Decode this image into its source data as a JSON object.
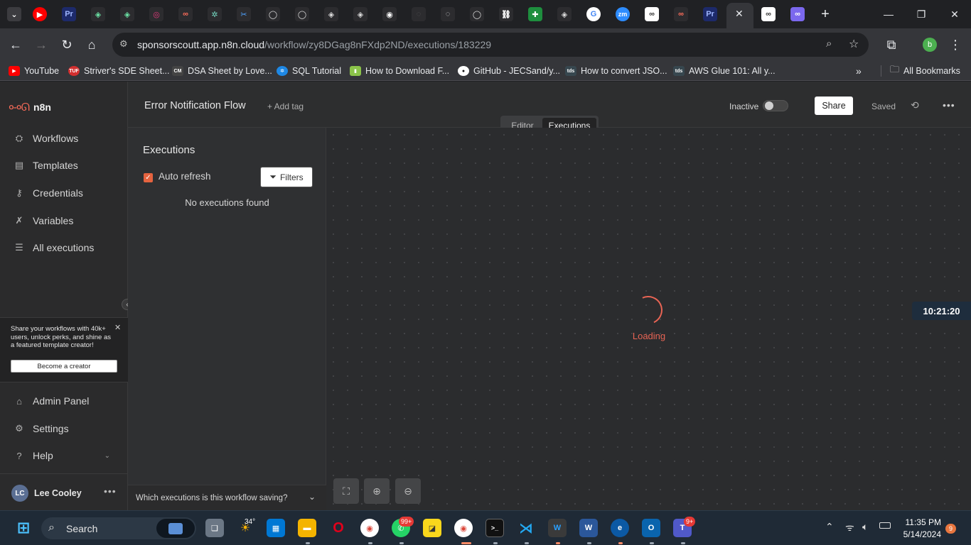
{
  "browser": {
    "url_host": "sponsorscoutt.app.n8n.cloud",
    "url_path": "/workflow/zy8DGag8nFXdp2ND/executions/183229",
    "tab_favicons": [
      "youtube-icon",
      "premiere-icon",
      "openai-icon",
      "openai-icon",
      "globe-icon",
      "n8n-icon",
      "chatgpt-icon",
      "scissors-icon",
      "github-icon",
      "github-icon",
      "openai-icon",
      "openai-icon",
      "chrome-icon",
      "loading-icon",
      "loading-icon",
      "github-icon",
      "link-icon",
      "sheets-icon",
      "openai-icon",
      "google-icon",
      "zoom-icon",
      "n8n-icon",
      "n8n-icon",
      "premiere-icon",
      "n8n-icon",
      "n8n-icon"
    ],
    "profile_initial": "b",
    "bookmarks": [
      {
        "label": "YouTube",
        "icon": "youtube-icon",
        "color": "#ff0000"
      },
      {
        "label": "Striver's SDE Sheet...",
        "icon": "tuf-icon",
        "color": "#d32f2f"
      },
      {
        "label": "DSA Sheet by Love...",
        "icon": "cm-icon",
        "color": "#444444"
      },
      {
        "label": "SQL Tutorial",
        "icon": "gear-icon",
        "color": "#1e88e5"
      },
      {
        "label": "How to Download F...",
        "icon": "android-icon",
        "color": "#8bc34a"
      },
      {
        "label": "GitHub - JECSand/y...",
        "icon": "github-icon",
        "color": "#333333"
      },
      {
        "label": "How to convert JSO...",
        "icon": "tds-icon",
        "color": "#37474f"
      },
      {
        "label": "AWS Glue 101: All y...",
        "icon": "tds-icon",
        "color": "#37474f"
      }
    ],
    "all_bookmarks": "All Bookmarks"
  },
  "sidebar": {
    "logo": "n8n",
    "items": [
      {
        "label": "Workflows",
        "icon": "workflows-icon"
      },
      {
        "label": "Templates",
        "icon": "templates-icon"
      },
      {
        "label": "Credentials",
        "icon": "key-icon"
      },
      {
        "label": "Variables",
        "icon": "variables-icon"
      },
      {
        "label": "All executions",
        "icon": "list-icon"
      }
    ],
    "promo_text": "Share your workflows with 40k+ users, unlock perks, and shine as a featured template creator!",
    "promo_button": "Become a creator",
    "bottom_items": [
      {
        "label": "Admin Panel",
        "icon": "home-icon"
      },
      {
        "label": "Settings",
        "icon": "gear-icon"
      },
      {
        "label": "Help",
        "icon": "question-icon"
      }
    ],
    "user_initials": "LC",
    "user_name": "Lee Cooley"
  },
  "header": {
    "workflow_name": "Error Notification Flow",
    "add_tag": "+ Add tag",
    "status": "Inactive",
    "share": "Share",
    "saved": "Saved",
    "tabs": {
      "editor": "Editor",
      "executions": "Executions"
    }
  },
  "executions": {
    "title": "Executions",
    "auto_refresh": "Auto refresh",
    "filters": "Filters",
    "empty": "No executions found",
    "saving_question": "Which executions is this workflow saving?"
  },
  "canvas": {
    "loading": "Loading",
    "clock": "10:21:20",
    "accent": "#e86454"
  },
  "taskbar": {
    "search": "Search",
    "weather": "34°",
    "whatsapp_badge": "99+",
    "teams_badge": "9+",
    "time": "11:35 PM",
    "date": "5/14/2024",
    "notification_count": "9"
  }
}
